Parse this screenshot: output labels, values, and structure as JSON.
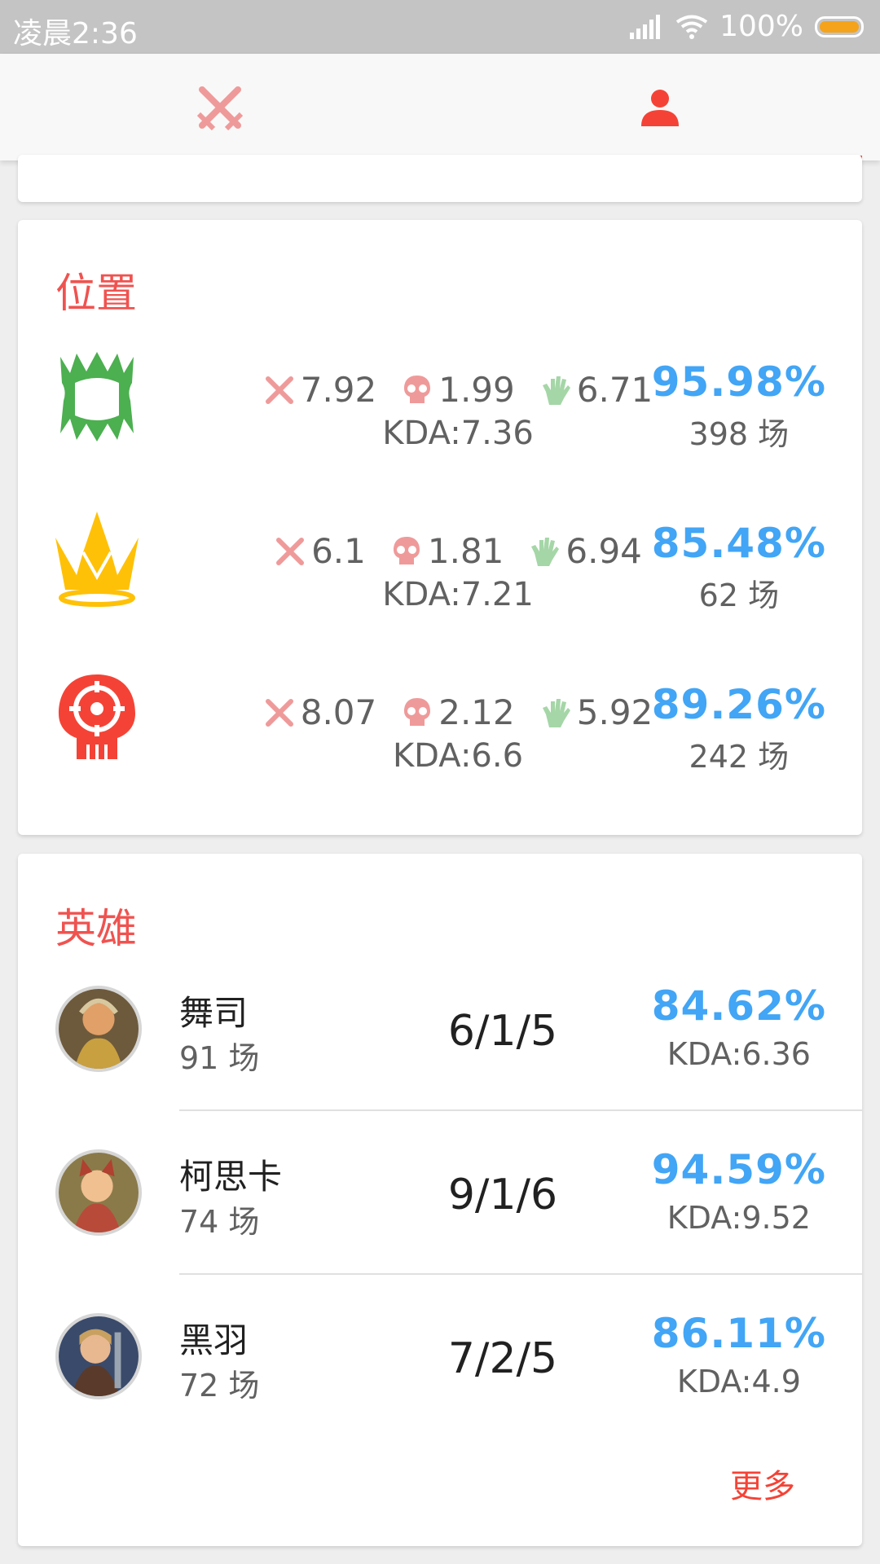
{
  "status_bar": {
    "time": "凌晨2:36",
    "battery": "100%"
  },
  "tabs": [
    {
      "icon": "crossed-swords-icon"
    },
    {
      "icon": "person-icon",
      "active": true
    }
  ],
  "position_section": {
    "title": "位置",
    "rows": [
      {
        "icon": "fang-icon",
        "kills": "7.92",
        "deaths": "1.99",
        "assists": "6.71",
        "kda": "KDA:7.36",
        "win_rate": "95.98%",
        "games": "398 场"
      },
      {
        "icon": "crown-icon",
        "kills": "6.1",
        "deaths": "1.81",
        "assists": "6.94",
        "kda": "KDA:7.21",
        "win_rate": "85.48%",
        "games": "62 场"
      },
      {
        "icon": "skull-target-icon",
        "kills": "8.07",
        "deaths": "2.12",
        "assists": "5.92",
        "kda": "KDA:6.6",
        "win_rate": "89.26%",
        "games": "242 场"
      }
    ]
  },
  "hero_section": {
    "title": "英雄",
    "heroes": [
      {
        "name": "舞司",
        "games": "91 场",
        "score": "6/1/5",
        "win_rate": "84.62%",
        "kda": "KDA:6.36"
      },
      {
        "name": "柯思卡",
        "games": "74 场",
        "score": "9/1/6",
        "win_rate": "94.59%",
        "kda": "KDA:9.52"
      },
      {
        "name": "黑羽",
        "games": "72 场",
        "score": "7/2/5",
        "win_rate": "86.11%",
        "kda": "KDA:4.9"
      }
    ],
    "more_label": "更多"
  },
  "colors": {
    "accent": "#f44336",
    "win_rate": "#42a5f5",
    "kill": "#ef9a9a",
    "assist": "#a5d6a7"
  }
}
